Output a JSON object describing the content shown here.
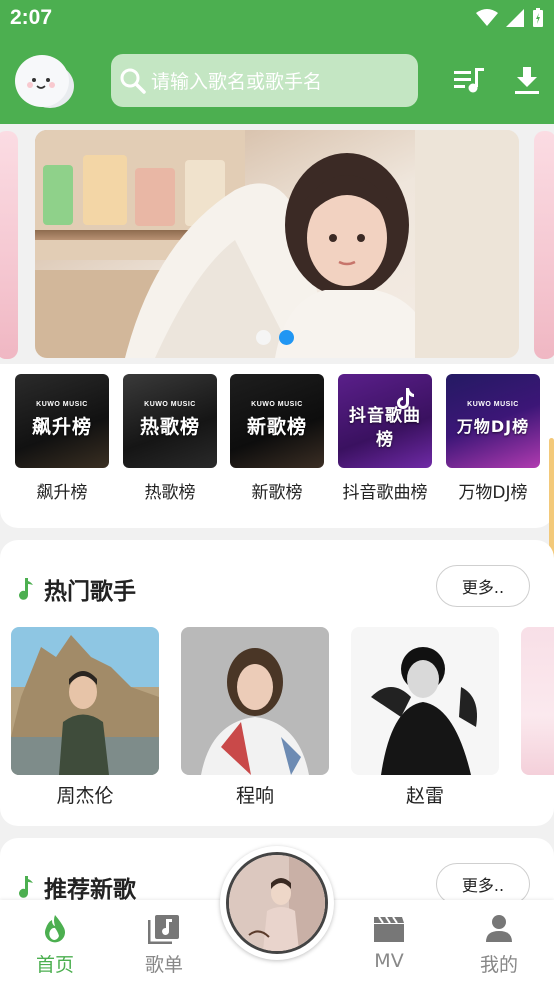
{
  "status": {
    "time": "2:07"
  },
  "header": {
    "search_placeholder": "请输入歌名或歌手名",
    "accent": "#4caf50"
  },
  "banner": {
    "dot_count": 2,
    "active_index": 1
  },
  "ranks": [
    {
      "brand": "KUWO MUSIC",
      "title": "飙升榜",
      "label": "飙升榜"
    },
    {
      "brand": "KUWO MUSIC",
      "title": "热歌榜",
      "label": "热歌榜"
    },
    {
      "brand": "KUWO MUSIC",
      "title": "新歌榜",
      "label": "新歌榜"
    },
    {
      "brand": "",
      "title": "抖音歌曲榜",
      "label": "抖音歌曲榜"
    },
    {
      "brand": "KUWO MUSIC",
      "title": "万物DJ榜",
      "label": "万物DJ榜"
    }
  ],
  "singers_section": {
    "title": "热门歌手",
    "more": "更多..",
    "singers": [
      {
        "name": "周杰伦"
      },
      {
        "name": "程响"
      },
      {
        "name": "赵雷"
      }
    ]
  },
  "songs_section": {
    "title": "推荐新歌",
    "more": "更多.."
  },
  "nav": {
    "items": [
      {
        "label": "首页",
        "icon": "home-flame-icon"
      },
      {
        "label": "歌单",
        "icon": "playlist-icon"
      },
      {
        "label": "MV",
        "icon": "mv-icon"
      },
      {
        "label": "我的",
        "icon": "profile-icon"
      }
    ]
  }
}
